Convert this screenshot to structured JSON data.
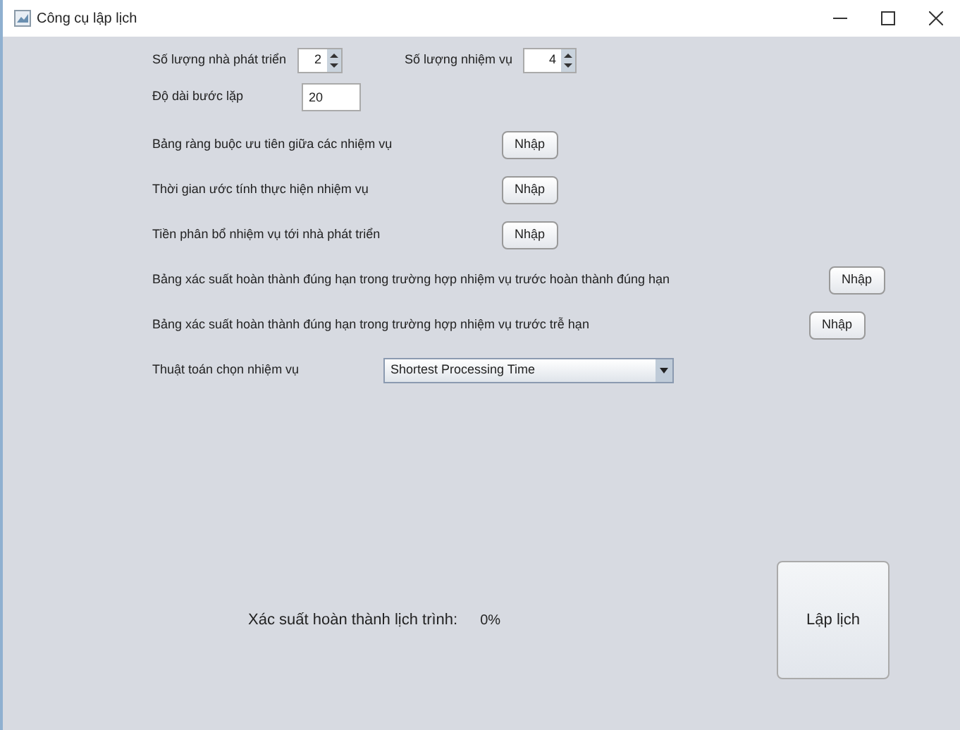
{
  "window": {
    "title": "Công cụ lập lịch"
  },
  "developers": {
    "label": "Số lượng nhà phát triển",
    "value": "2"
  },
  "tasks": {
    "label": "Số lượng nhiệm vụ",
    "value": "4"
  },
  "step": {
    "label": "Độ dài bước lặp",
    "value": "20"
  },
  "inputs": [
    {
      "label": "Bảng ràng buộc ưu tiên giữa các nhiệm vụ",
      "button": "Nhập"
    },
    {
      "label": "Thời gian ước tính thực hiện nhiệm vụ",
      "button": "Nhập"
    },
    {
      "label": "Tiền phân bổ nhiệm vụ tới nhà phát triển",
      "button": "Nhập"
    },
    {
      "label": "Bảng xác suất hoàn thành đúng hạn trong trường hợp nhiệm vụ trước hoàn thành đúng hạn",
      "button": "Nhập"
    },
    {
      "label": "Bảng xác suất hoàn thành đúng hạn trong trường hợp nhiệm vụ trước trễ hạn",
      "button": "Nhập"
    }
  ],
  "algorithm": {
    "label": "Thuật toán chọn nhiệm vụ",
    "value": "Shortest Processing Time"
  },
  "result": {
    "label": "Xác suất hoàn thành lịch trình:",
    "value": "0%"
  },
  "schedule_button": "Lập lịch"
}
